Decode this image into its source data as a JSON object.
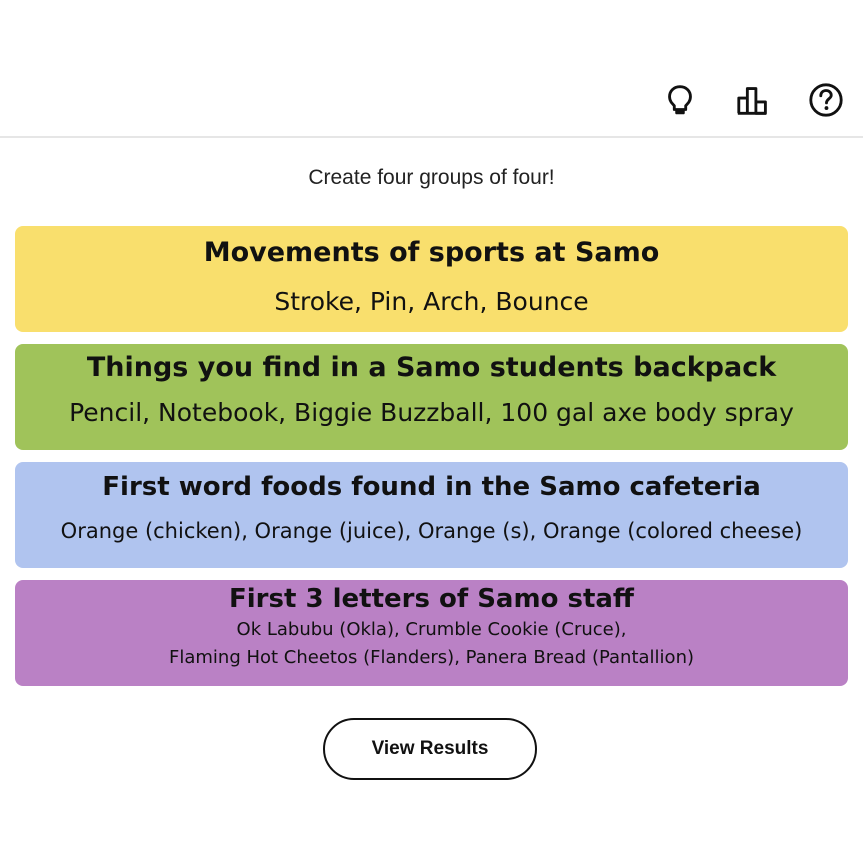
{
  "header": {
    "icons": [
      "lightbulb-icon",
      "stats-icon",
      "help-icon"
    ]
  },
  "subtitle": "Create four groups of four!",
  "groups": [
    {
      "title": "Movements of sports at Samo",
      "members_line1": "Stroke, Pin, Arch, Bounce",
      "color": "#f9df6d"
    },
    {
      "title": "Things you find in a Samo students backpack",
      "members_line1": "Pencil, Notebook, Biggie Buzzball, 100 gal axe body spray",
      "color": "#a0c35a"
    },
    {
      "title": "First word foods found in the Samo cafeteria",
      "members_line1": "Orange (chicken), Orange (juice), Orange (s), Orange (colored cheese)",
      "color": "#b0c4ef"
    },
    {
      "title": "First 3 letters of Samo staff",
      "members_line1": "Ok Labubu (Okla), Crumble Cookie (Cruce),",
      "members_line2": "Flaming Hot Cheetos (Flanders), Panera Bread (Pantallion)",
      "color": "#ba81c5"
    }
  ],
  "view_results_label": "View Results"
}
